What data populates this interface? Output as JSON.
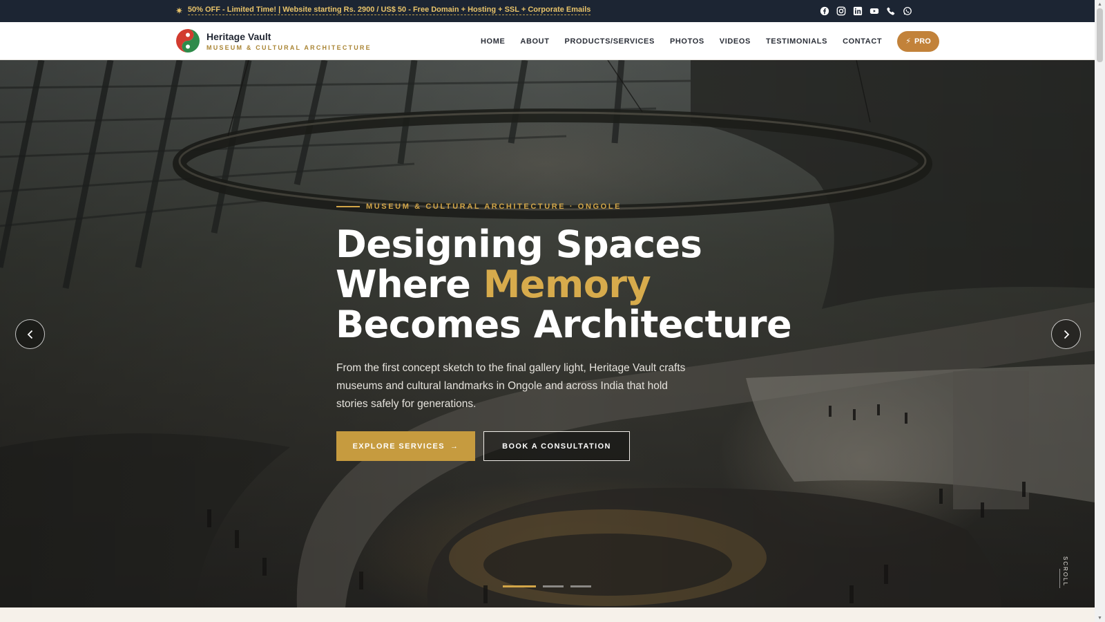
{
  "promo": {
    "icon": "sparkle-icon",
    "text": "50% OFF - Limited Time! | Website starting Rs. 2900 / US$ 50 - Free Domain + Hosting + SSL + Corporate Emails"
  },
  "socials": [
    "facebook-icon",
    "instagram-icon",
    "linkedin-icon",
    "youtube-icon",
    "phone-icon",
    "whatsapp-icon"
  ],
  "brand": {
    "name": "Heritage Vault",
    "tagline": "MUSEUM & CULTURAL ARCHITECTURE"
  },
  "nav": {
    "items": [
      "HOME",
      "ABOUT",
      "PRODUCTS/SERVICES",
      "PHOTOS",
      "VIDEOS",
      "TESTIMONIALS",
      "CONTACT"
    ],
    "pro_label": "PRO"
  },
  "hero": {
    "eyebrow": "MUSEUM & CULTURAL ARCHITECTURE · ONGOLE",
    "headline_line1": "Designing Spaces",
    "headline_line2_a": "Where ",
    "headline_line2_accent": "Memory",
    "headline_line3": "Becomes Architecture",
    "lede": "From the first concept sketch to the final gallery light, Heritage Vault crafts museums and cultural landmarks in Ongole and across India that hold stories safely for generations.",
    "cta_primary": "EXPLORE SERVICES",
    "cta_secondary": "BOOK A CONSULTATION",
    "scroll_label": "SCROLL",
    "slides_total": 3,
    "slide_active": 1
  },
  "colors": {
    "topbar_bg": "#1c2533",
    "promo_text": "#e9c46a",
    "accent_gold": "#d3a648",
    "pro_button": "#c2823a",
    "primary_button": "#c69b3f"
  }
}
